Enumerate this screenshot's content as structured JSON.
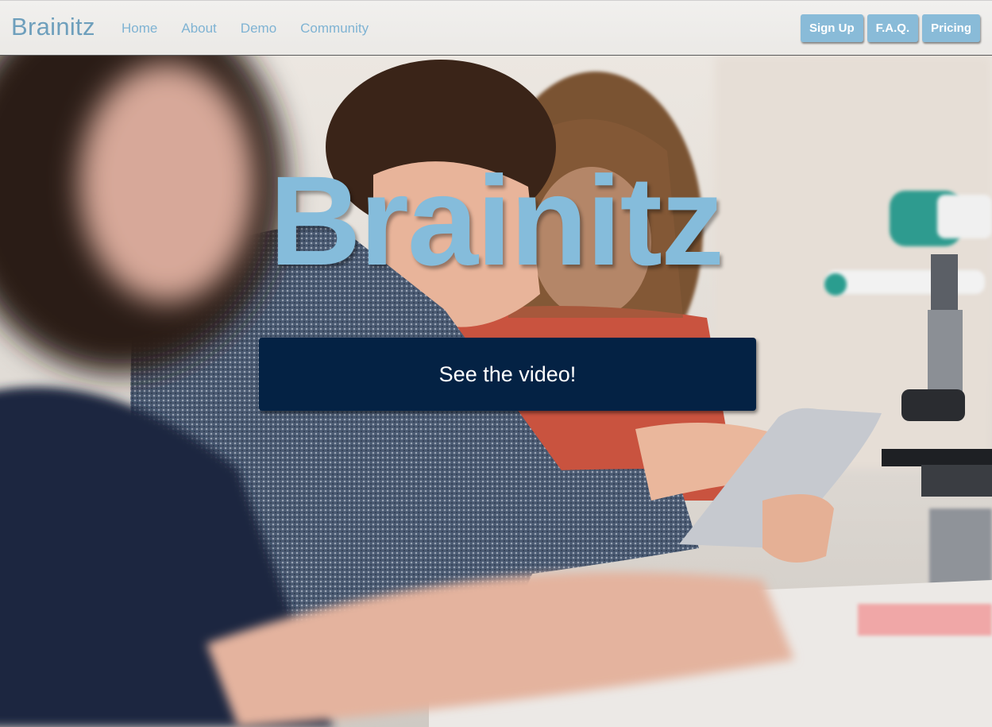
{
  "navbar": {
    "brand": "Brainitz",
    "links": [
      "Home",
      "About",
      "Demo",
      "Community"
    ],
    "buttons": [
      "Sign Up",
      "F.A.Q.",
      "Pricing"
    ]
  },
  "hero": {
    "title": "Brainitz",
    "cta_label": "See the video!",
    "image_alt": "students-using-tablet-in-lab-photo"
  },
  "colors": {
    "brand_blue": "#85bcdb",
    "nav_button": "#89bbd8",
    "cta_navy": "#042244"
  }
}
